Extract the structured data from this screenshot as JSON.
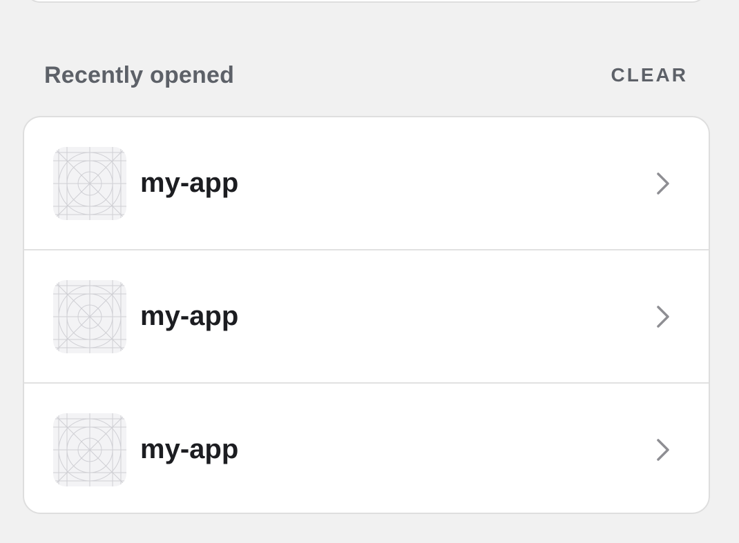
{
  "recent": {
    "title": "Recently opened",
    "clear_label": "CLEAR",
    "items": [
      {
        "name": "my-app",
        "icon": "app-placeholder-icon"
      },
      {
        "name": "my-app",
        "icon": "app-placeholder-icon"
      },
      {
        "name": "my-app",
        "icon": "app-placeholder-icon"
      }
    ]
  },
  "colors": {
    "background": "#f1f1f1",
    "card": "#ffffff",
    "header_text": "#5d6168",
    "item_text": "#1c1d21",
    "chevron": "#8e8e93"
  }
}
